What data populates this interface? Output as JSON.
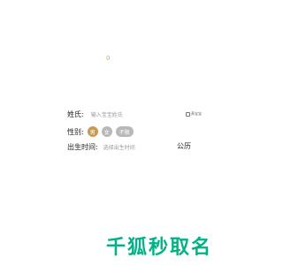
{
  "counter": "0",
  "form": {
    "surname": {
      "label": "姓氏:",
      "placeholder": "输入宝宝姓氏"
    },
    "auto_option": {
      "label": "养宝宝"
    },
    "gender": {
      "label": "性别:",
      "options": [
        "男",
        "女",
        "不限"
      ],
      "selected": "男"
    },
    "birth": {
      "label": "出生时间:",
      "placeholder": "选择出生时间",
      "calendar": "公历"
    }
  },
  "submit": {
    "label": "千狐秒取名"
  },
  "colors": {
    "accent_gold": "#c89a52",
    "submit_green": "#00b386",
    "placeholder_gray": "#9a9a9a"
  }
}
